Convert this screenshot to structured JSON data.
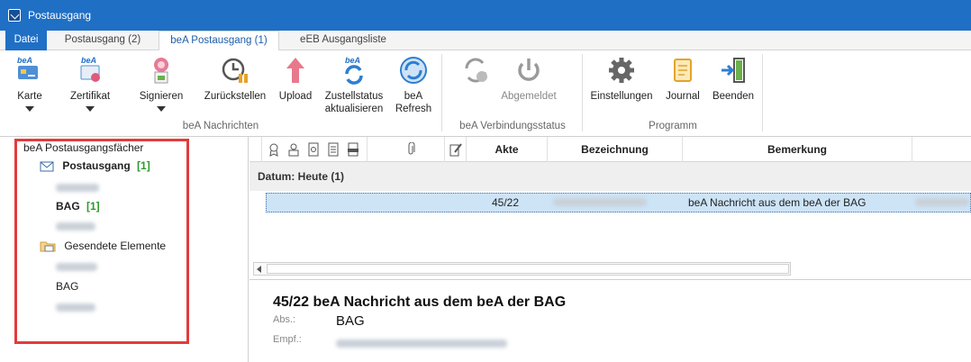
{
  "window": {
    "title": "Postausgang"
  },
  "tabs": {
    "file": "Datei",
    "postausgang": "Postausgang (2)",
    "bea_postausgang": "beA Postausgang (1)",
    "eeb": "eEB Ausgangsliste"
  },
  "ribbon": {
    "karte": "Karte",
    "zertifikat": "Zertifikat",
    "signieren": "Signieren",
    "zurueckstellen": "Zurückstellen",
    "upload": "Upload",
    "zustellstatus_1": "Zustellstatus",
    "zustellstatus_2": "aktualisieren",
    "bea_refresh_1": "beA",
    "bea_refresh_2": "Refresh",
    "abgemeldet": "Abgemeldet",
    "einstellungen": "Einstellungen",
    "journal": "Journal",
    "beenden": "Beenden",
    "group_nachrichten": "beA Nachrichten",
    "group_verbindung": "beA Verbindungsstatus",
    "group_programm": "Programm"
  },
  "tree": {
    "root": "beA Postausgangsfächer",
    "postausgang": {
      "label": "Postausgang",
      "count": "[1]"
    },
    "bag": {
      "label": "BAG",
      "count": "[1]"
    },
    "gesendete": "Gesendete Elemente",
    "bag2": "BAG"
  },
  "grid": {
    "columns": {
      "akte": "Akte",
      "bezeichnung": "Bezeichnung",
      "bemerkung": "Bemerkung"
    },
    "group": "Datum: Heute (1)",
    "row": {
      "akte": "45/22",
      "bemerkung": "beA Nachricht aus dem beA der BAG"
    }
  },
  "preview": {
    "subject": "45/22 beA Nachricht aus dem beA der BAG",
    "abs_label": "Abs.:",
    "abs_value": "BAG",
    "empf_label": "Empf.:"
  },
  "colors": {
    "accent": "#1f6fc5",
    "highlight": "#e23b3b",
    "selection": "#cde4f7",
    "count_green": "#2c9a2c"
  }
}
